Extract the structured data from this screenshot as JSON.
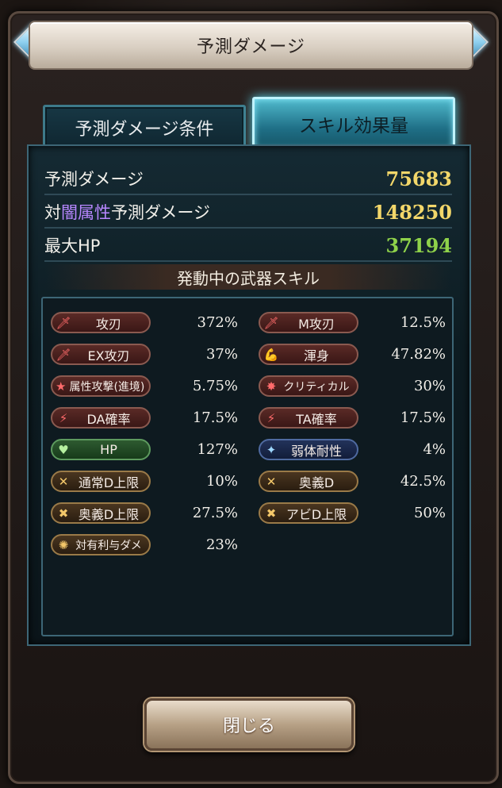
{
  "title": "予測ダメージ",
  "tabs": [
    {
      "label": "予測ダメージ条件",
      "active": false
    },
    {
      "label": "スキル効果量",
      "active": true
    }
  ],
  "stats": {
    "damage": {
      "label": "予測ダメージ",
      "value": "75683",
      "color": "#f3d76a"
    },
    "dark_damage": {
      "prefix": "対",
      "element": "闇属性",
      "suffix": "予測ダメージ",
      "value": "148250",
      "color": "#f3d76a"
    },
    "max_hp": {
      "label": "最大HP",
      "value": "37194",
      "color": "#8fd24a"
    }
  },
  "section_title": "発動中の武器スキル",
  "skills": [
    {
      "name": "攻刃",
      "value": "372%",
      "icon": "sword-icon",
      "style": "red"
    },
    {
      "name": "M攻刃",
      "value": "12.5%",
      "icon": "sword-icon",
      "style": "red"
    },
    {
      "name": "EX攻刃",
      "value": "37%",
      "icon": "sword-icon",
      "style": "red"
    },
    {
      "name": "渾身",
      "value": "47.82%",
      "icon": "muscle-icon",
      "style": "red"
    },
    {
      "name": "属性攻撃(進境)",
      "value": "5.75%",
      "icon": "star-icon",
      "style": "red"
    },
    {
      "name": "クリティカル",
      "value": "30%",
      "icon": "burst-icon",
      "style": "red"
    },
    {
      "name": "DA確率",
      "value": "17.5%",
      "icon": "double-slash-icon",
      "style": "red"
    },
    {
      "name": "TA確率",
      "value": "17.5%",
      "icon": "triple-slash-icon",
      "style": "red"
    },
    {
      "name": "HP",
      "value": "127%",
      "icon": "heart-icon",
      "style": "green"
    },
    {
      "name": "弱体耐性",
      "value": "4%",
      "icon": "resist-icon",
      "style": "blue"
    },
    {
      "name": "通常D上限",
      "value": "10%",
      "icon": "cap-icon",
      "style": "gold"
    },
    {
      "name": "奥義D",
      "value": "42.5%",
      "icon": "cross-swords-icon",
      "style": "gold"
    },
    {
      "name": "奥義D上限",
      "value": "27.5%",
      "icon": "ougi-cap-icon",
      "style": "gold"
    },
    {
      "name": "アビD上限",
      "value": "50%",
      "icon": "ability-cap-icon",
      "style": "gold"
    },
    {
      "name": "対有利与ダメ",
      "value": "23%",
      "icon": "sun-icon",
      "style": "gold"
    }
  ],
  "close_button": "閉じる"
}
